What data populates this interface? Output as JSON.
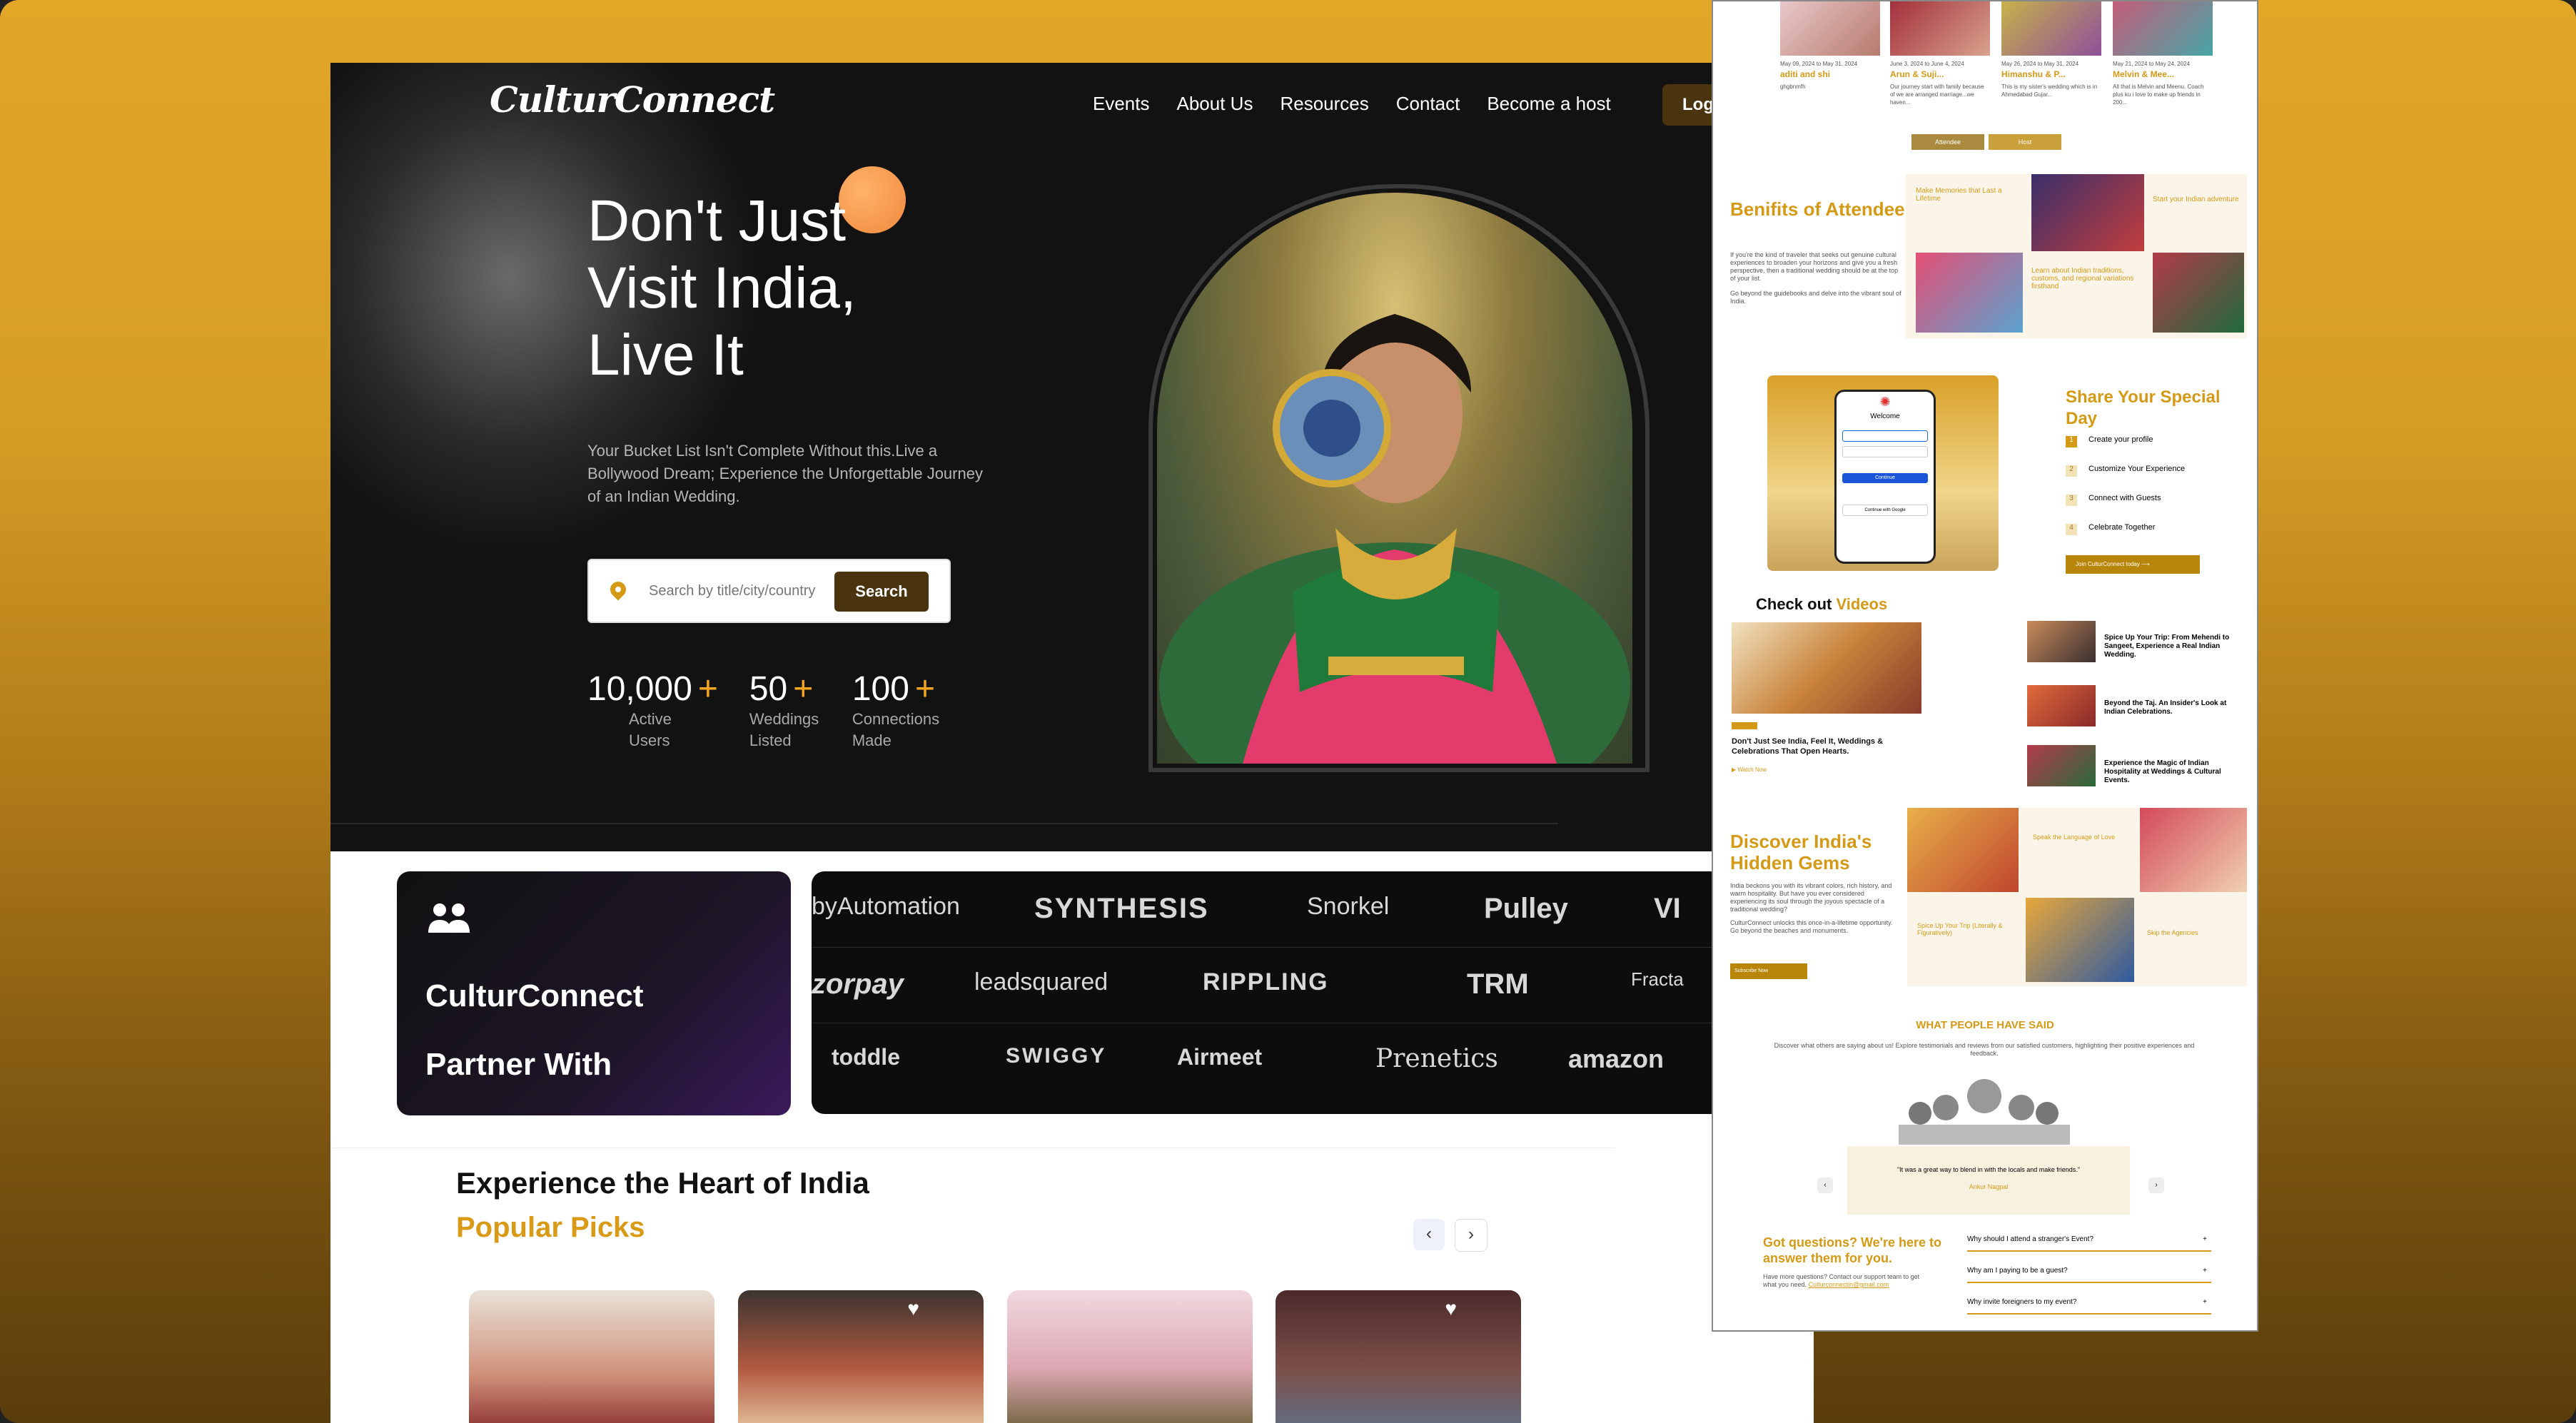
{
  "brand": {
    "logo_text": "CulturConnect"
  },
  "nav": {
    "items": [
      "Events",
      "About Us",
      "Resources",
      "Contact",
      "Become a host"
    ],
    "login": "Log"
  },
  "hero": {
    "title_lines": [
      "Don't Just",
      "Visit India,",
      "Live It"
    ],
    "subtitle": "Your Bucket List Isn't Complete Without this.Live a Bollywood Dream; Experience the Unforgettable Journey of an Indian Wedding.",
    "search_placeholder": "Search by title/city/country",
    "search_button": "Search",
    "stats": [
      {
        "value": "10,000",
        "plus": "+",
        "label": "Active Users"
      },
      {
        "value": "50",
        "plus": "+",
        "label": "Weddings Listed"
      },
      {
        "value": "100",
        "plus": "+",
        "label": "Connections Made"
      }
    ]
  },
  "partners": {
    "line1": "CulturConnect",
    "line2": "Partner With",
    "brands_row1": [
      "byAutomation",
      "SYNTHESIS",
      "Snorkel",
      "Pulley",
      "VI"
    ],
    "brands_row2": [
      "zorpay",
      "leadsquared",
      "RIPPLING",
      "TRM",
      "Fracta"
    ],
    "brands_row3": [
      "toddle",
      "SWIGGY",
      "Airmeet",
      "Prenetics",
      "amazon"
    ]
  },
  "experience": {
    "title": "Experience the Heart of India",
    "subtitle": "Popular Picks",
    "prev": "‹",
    "next": "›"
  },
  "panel": {
    "top_cards": [
      {
        "date": "May 09, 2024 to May 31, 2024",
        "name": "aditi and shi",
        "desc": "ghgbnmfh"
      },
      {
        "date": "June 3, 2024 to June 4, 2024",
        "name": "Arun & Suji...",
        "desc": "Our journey start with family because of we are arranged marriage...we haven..."
      },
      {
        "date": "May 26, 2024 to May 31, 2024",
        "name": "Himanshu & P...",
        "desc": "This is my sister's wedding which is in Ahmedabad Gujar..."
      },
      {
        "date": "May 21, 2024 to May 24, 2024",
        "name": "Melvin & Mee...",
        "desc": "All that is Melvin and Meenu. Coach plus ku i love to make up friends in 200..."
      }
    ],
    "toggle": [
      "Attendee",
      "Host"
    ],
    "benefits": {
      "title": "Benifits of Attendee",
      "p1": "If you're the kind of traveler that seeks out genuine cultural experiences to broaden your horizons and give you a fresh perspective, then a traditional wedding should be at the top of your list.",
      "p2": "Go beyond the guidebooks and delve into the vibrant soul of India.",
      "cards": [
        "Make Memories that Last a Lifetime",
        "Learn about Indian traditions, customs, and regional variations firsthand",
        "Start your Indian adventure"
      ]
    },
    "share": {
      "title": "Share Your Special Day",
      "steps": [
        "Create your profile",
        "Customize Your Experience",
        "Connect with Guests",
        "Celebrate Together"
      ],
      "cta": "Join CulturConnect today",
      "login_card": {
        "heading": "Welcome",
        "continue": "Continue",
        "google": "Continue with Google"
      }
    },
    "videos": {
      "title": "Check out",
      "title_accent": "Videos",
      "main_caption": "Don't Just See India, Feel It, Weddings & Celebrations That Open Hearts.",
      "watch": "Watch Now",
      "items": [
        "Spice Up Your Trip: From Mehendi to Sangeet, Experience a Real Indian Wedding.",
        "Beyond the Taj. An Insider's Look at Indian Celebrations.",
        "Experience the Magic of Indian Hospitality at Weddings & Cultural Events."
      ]
    },
    "gems": {
      "title": "Discover India's Hidden Gems",
      "p1": "India beckons you with its vibrant colors, rich history, and warm hospitality. But have you ever considered experiencing its soul through the joyous spectacle of a traditional wedding?",
      "p2": "CulturConnect unlocks this once-in-a-lifetime opportunity. Go beyond the beaches and monuments.",
      "cta": "Subscribe Now",
      "cards": [
        "Speak the Language of Love",
        "Spice Up Your Trip (Literally & Figuratively)",
        "Skip the Agencies"
      ]
    },
    "testimonials": {
      "title": "WHAT PEOPLE HAVE SAID",
      "sub": "Discover what others are saying about us! Explore testimonials and reviews from our satisfied customers, highlighting their positive experiences and feedback.",
      "quote": "\"It was a great way to blend in with the locals and make friends.\"",
      "author": "Ankur Nagpal"
    },
    "faq": {
      "title": "Got questions? We're here to answer them for you.",
      "sub": "Have more questions? Contact our support team to get what you need.",
      "email": "Culturconnectin@gmail.com",
      "questions": [
        "Why should I attend a stranger's Event?",
        "Why am I paying to be a guest?",
        "Why invite foreigners to my event?"
      ]
    }
  }
}
